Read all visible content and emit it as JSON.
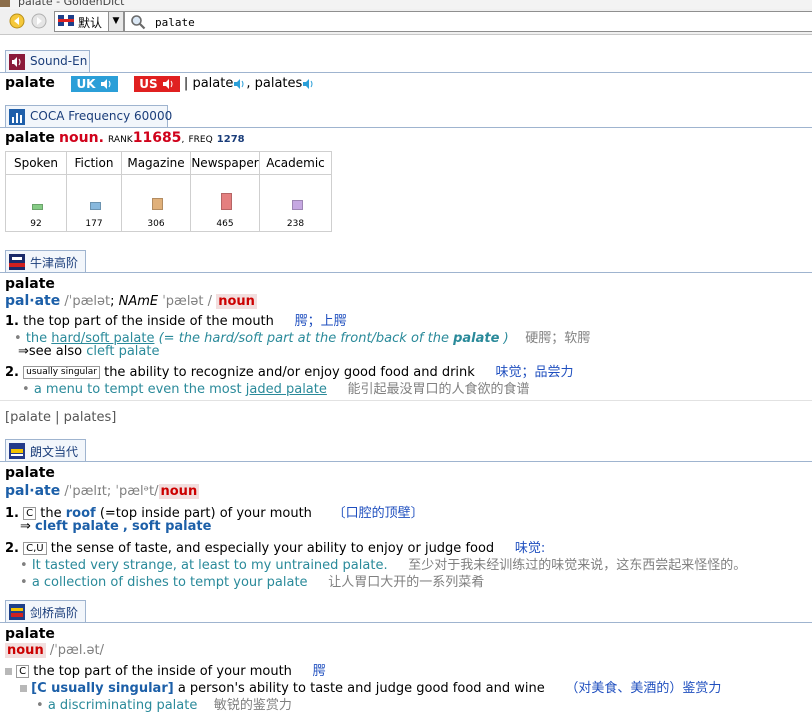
{
  "title": "palate - GoldenDict",
  "toolbar": {
    "lang_label": "默认",
    "search_value": "palate"
  },
  "sound": {
    "tab": "Sound-En",
    "word": "palate",
    "uk": "UK",
    "us": "US",
    "sep": "|",
    "form1": "palate",
    "comma": ",",
    "form2": "palates"
  },
  "coca": {
    "tab": "COCA Frequency 60000",
    "word": "palate",
    "pos": "noun.",
    "rank_label": "RANK",
    "rank": "11685",
    "freq_label": "FREQ",
    "freq": "1278",
    "columns": [
      "Spoken",
      "Fiction",
      "Magazine",
      "Newspaper",
      "Academic"
    ],
    "values": [
      92,
      177,
      306,
      465,
      238
    ],
    "bar_colors": [
      "#86cc86",
      "#88b8dd",
      "#e0b07a",
      "#e47f7f",
      "#c6a8e2"
    ]
  },
  "oxford": {
    "tab": "牛津高阶",
    "word": "palate",
    "syll": "pal·ate",
    "pron_uk": "/ˈpælət",
    "semi": ";",
    "name_label": "NAmE",
    "pron_us": "ˈpælət /",
    "pos": "noun",
    "s1_num": "1.",
    "s1_def": "the top part of the inside of the mouth",
    "s1_zh": "腭；上腭",
    "s1_ex_pre": "the",
    "s1_ex_link": "hard/soft palate",
    "s1_ex_mid": "(= the hard/soft part at the front/back of the",
    "s1_ex_bold": "palate",
    "s1_ex_end": ")",
    "s1_ex_zh": "硬腭；软腭",
    "s1_see": "⇒see also",
    "s1_see_link": "cleft palate",
    "s2_num": "2.",
    "s2_tag": "usually singular",
    "s2_def": "the ability to recognize and/or enjoy good food and drink",
    "s2_zh": "味觉；品尝力",
    "s2_ex_pre": "a menu to tempt even the most",
    "s2_ex_link": "jaded palate",
    "s2_ex_zh": "能引起最没胃口的人食欲的食谱",
    "forms": "[palate | palates]"
  },
  "longman": {
    "tab": "朗文当代",
    "word": "palate",
    "syll": "pal·ate",
    "pron": "/ˈpælɪt; ˈpælᵊt/",
    "pos": "noun",
    "s1_num": "1.",
    "s1_tag": "C",
    "s1_def_pre": "the",
    "s1_roof": "roof",
    "s1_def_post": "(=top inside part) of your mouth",
    "s1_zh": "〔口腔的顶壁〕",
    "s1_see_arrow": "⇒",
    "s1_see1": "cleft palate",
    "s1_see_comma": ",",
    "s1_see2": "soft palate",
    "s2_num": "2.",
    "s2_tag": "C,U",
    "s2_def": "the sense of taste, and especially your ability to enjoy or judge food",
    "s2_zh": "味觉:",
    "s2_ex1": "It tasted very strange, at least to my untrained palate.",
    "s2_ex1_zh": "至少对于我未经训练过的味觉来说，这东西尝起来怪怪的。",
    "s2_ex2": "a collection of dishes to tempt your palate",
    "s2_ex2_zh": "让人胃口大开的一系列菜肴"
  },
  "cambridge": {
    "tab": "剑桥高阶",
    "word": "palate",
    "pos": "noun",
    "pron": "/ˈpæl.ət/",
    "s1_tag": "C",
    "s1_def": "the top part of the inside of your mouth",
    "s1_zh": "腭",
    "s2_gram": "[C usually singular]",
    "s2_def": "a person's ability to taste and judge good food and wine",
    "s2_zh": "（对美食、美酒的）鉴赏力",
    "s2_ex": "a discriminating palate",
    "s2_ex_zh": "敏锐的鉴赏力"
  }
}
